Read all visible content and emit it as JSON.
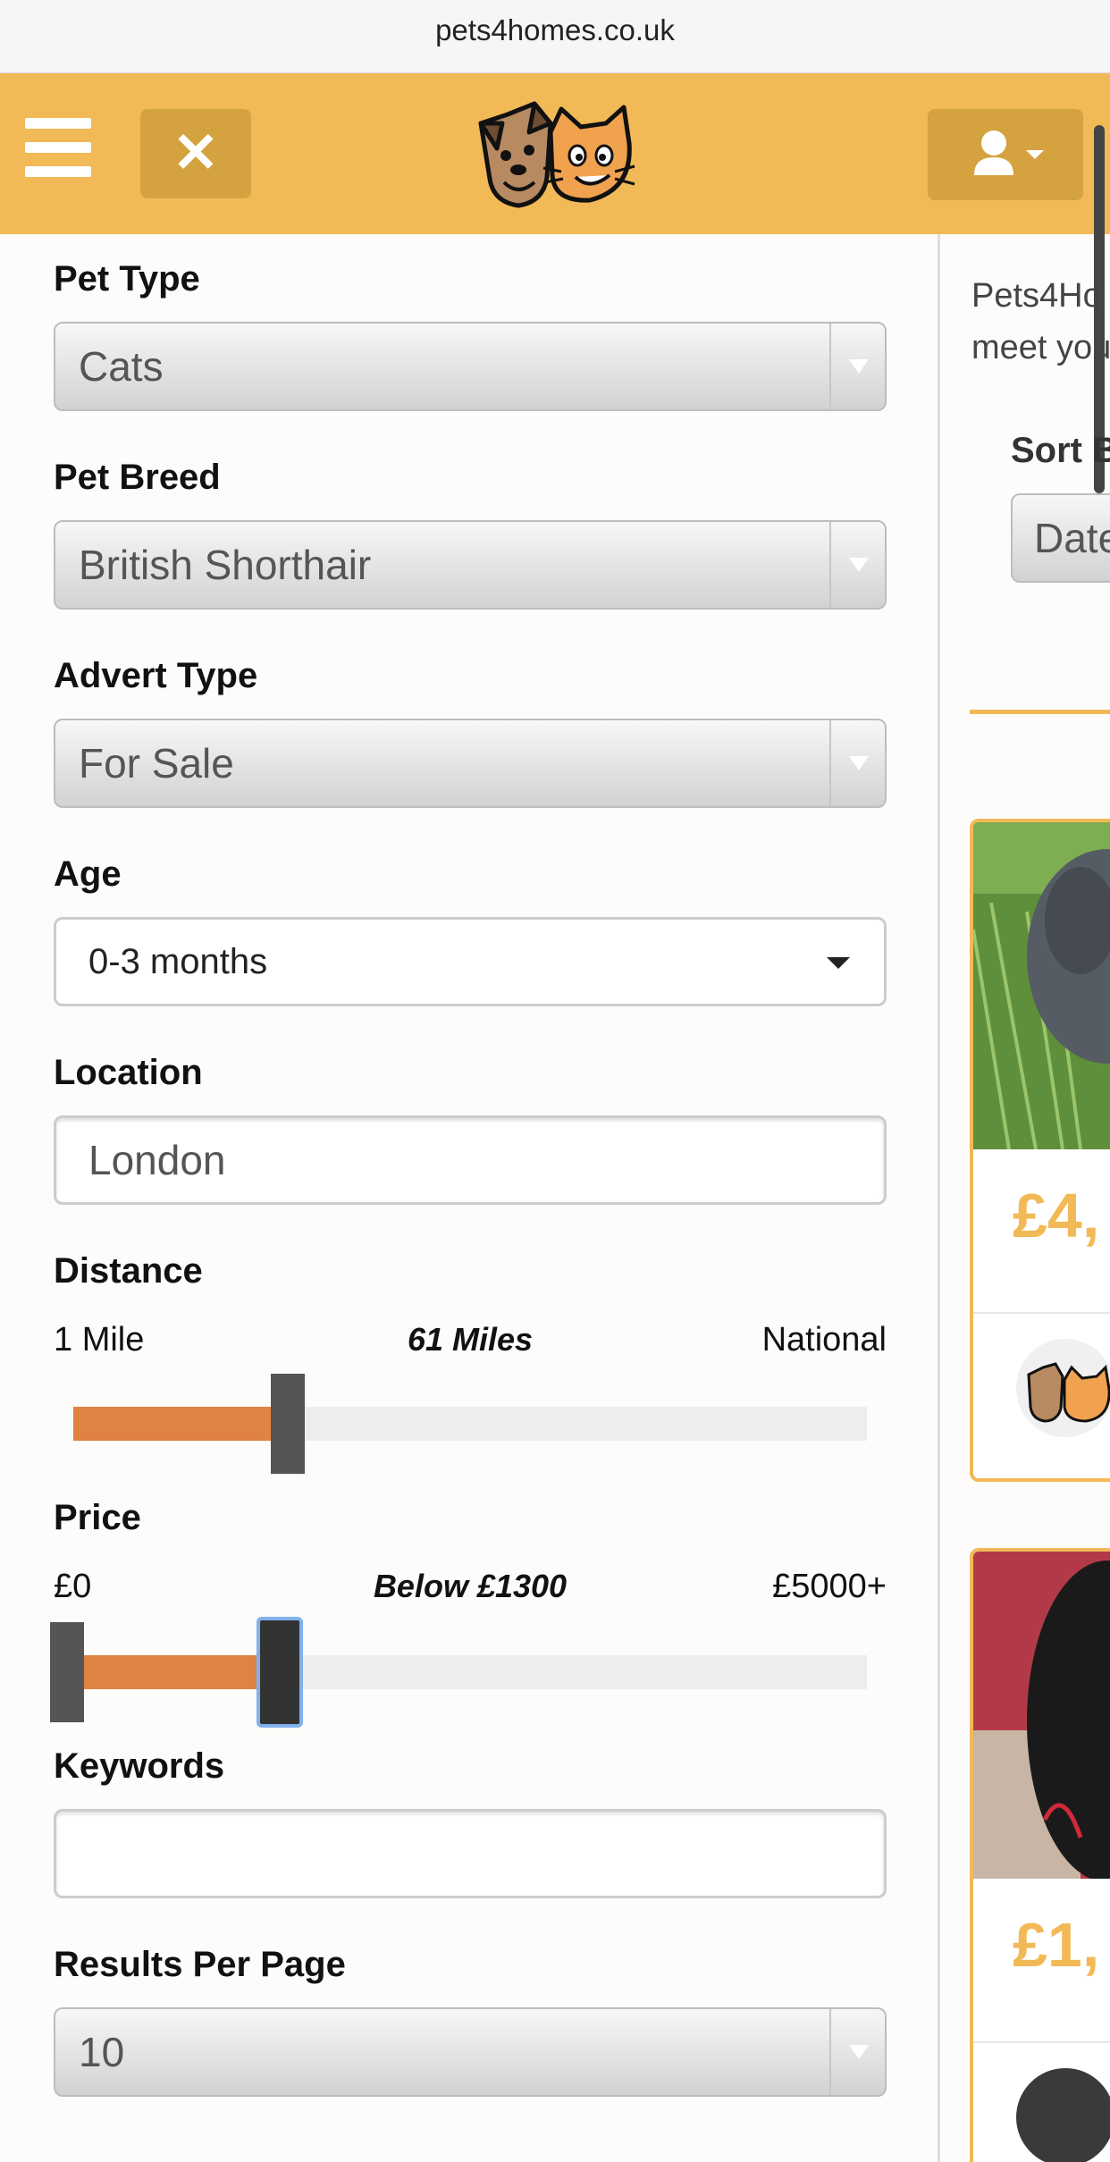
{
  "browser": {
    "url": "pets4homes.co.uk"
  },
  "header": {
    "menu_icon": "hamburger-icon",
    "close_icon": "close-icon",
    "logo_icon": "dog-cat-logo",
    "user_icon": "user-icon",
    "colors": {
      "brand": "#f2b957",
      "button": "#d4a33f"
    }
  },
  "filters": {
    "pet_type": {
      "label": "Pet Type",
      "value": "Cats"
    },
    "pet_breed": {
      "label": "Pet Breed",
      "value": "British Shorthair"
    },
    "advert_type": {
      "label": "Advert Type",
      "value": "For Sale"
    },
    "age": {
      "label": "Age",
      "value": "0-3 months"
    },
    "location": {
      "label": "Location",
      "value": "London"
    },
    "distance": {
      "label": "Distance",
      "min_label": "1 Mile",
      "current_label": "61 Miles",
      "max_label": "National",
      "fill_fraction": 0.27
    },
    "price": {
      "label": "Price",
      "min_label": "£0",
      "current_label": "Below £1300",
      "max_label": "£5000+",
      "low_fraction": 0.0,
      "high_fraction": 0.26
    },
    "keywords": {
      "label": "Keywords",
      "value": ""
    },
    "results_per_page": {
      "label": "Results Per Page",
      "value": "10"
    },
    "accent_color": "#e08243"
  },
  "results": {
    "intro_line1": "Pets4Ho",
    "intro_line2": "meet you",
    "sort_label": "Sort B",
    "sort_value": "Date",
    "cards": [
      {
        "price": "£4,"
      },
      {
        "price": "£1,"
      }
    ]
  }
}
